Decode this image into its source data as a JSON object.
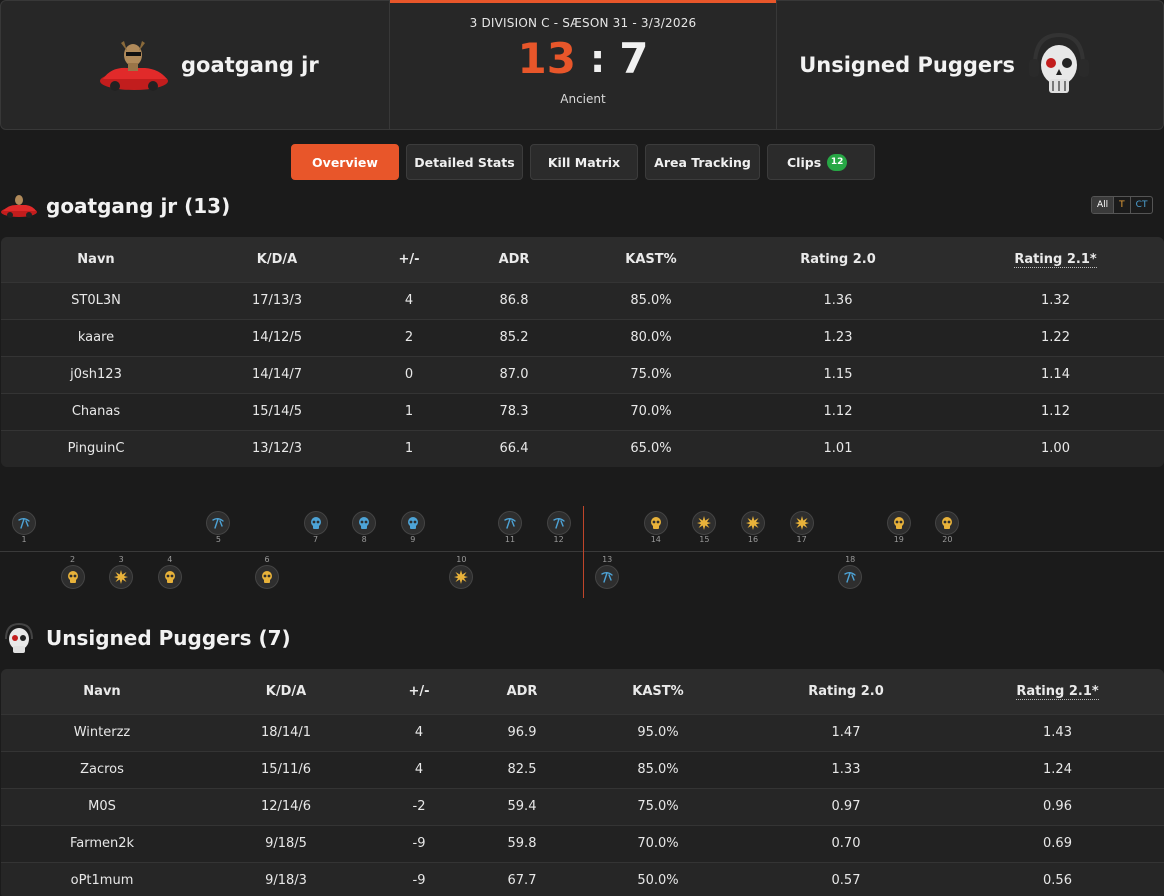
{
  "match": {
    "team1_name": "goatgang jr",
    "team2_name": "Unsigned Puggers",
    "info": "3 DIVISION C - SÆSON 31 - 3/3/2026",
    "score1": "13",
    "score_sep": ":",
    "score2": "7",
    "map": "Ancient"
  },
  "tabs": [
    {
      "label": "Overview",
      "active": true
    },
    {
      "label": "Detailed Stats"
    },
    {
      "label": "Kill Matrix"
    },
    {
      "label": "Area Tracking"
    },
    {
      "label": "Clips",
      "badge": "12"
    }
  ],
  "side_filter": [
    "All",
    "T",
    "CT"
  ],
  "team1_section": {
    "title": "goatgang jr (13)",
    "headers": [
      "Navn",
      "K/D/A",
      "+/-",
      "ADR",
      "KAST%",
      "Rating 2.0",
      "Rating 2.1*"
    ],
    "rows": [
      [
        "ST0L3N",
        "17/13/3",
        "4",
        "86.8",
        "85.0%",
        "1.36",
        "1.32"
      ],
      [
        "kaare",
        "14/12/5",
        "2",
        "85.2",
        "80.0%",
        "1.23",
        "1.22"
      ],
      [
        "j0sh123",
        "14/14/7",
        "0",
        "87.0",
        "75.0%",
        "1.15",
        "1.14"
      ],
      [
        "Chanas",
        "15/14/5",
        "1",
        "78.3",
        "70.0%",
        "1.12",
        "1.12"
      ],
      [
        "PinguinC",
        "13/12/3",
        "1",
        "66.4",
        "65.0%",
        "1.01",
        "1.00"
      ]
    ]
  },
  "team2_section": {
    "title": "Unsigned Puggers (7)",
    "headers": [
      "Navn",
      "K/D/A",
      "+/-",
      "ADR",
      "KAST%",
      "Rating 2.0",
      "Rating 2.1*"
    ],
    "rows": [
      [
        "Winterzz",
        "18/14/1",
        "4",
        "96.9",
        "95.0%",
        "1.47",
        "1.43"
      ],
      [
        "Zacros",
        "15/11/6",
        "4",
        "82.5",
        "85.0%",
        "1.33",
        "1.24"
      ],
      [
        "M0S",
        "12/14/6",
        "-2",
        "59.4",
        "75.0%",
        "0.97",
        "0.96"
      ],
      [
        "Farmen2k",
        "9/18/5",
        "-9",
        "59.8",
        "70.0%",
        "0.70",
        "0.69"
      ],
      [
        "oPt1mum",
        "9/18/3",
        "-9",
        "67.7",
        "50.0%",
        "0.57",
        "0.56"
      ]
    ]
  },
  "rounds": [
    {
      "n": "1",
      "winner": "top",
      "type": "defuse-icon",
      "color": "#4da3d6"
    },
    {
      "n": "2",
      "winner": "bottom",
      "type": "skull-icon",
      "color": "#e8b23a"
    },
    {
      "n": "3",
      "winner": "bottom",
      "type": "bomb-explode-icon",
      "color": "#e8b23a"
    },
    {
      "n": "4",
      "winner": "bottom",
      "type": "skull-icon",
      "color": "#e8b23a"
    },
    {
      "n": "5",
      "winner": "top",
      "type": "defuse-icon",
      "color": "#4da3d6"
    },
    {
      "n": "6",
      "winner": "bottom",
      "type": "skull-icon",
      "color": "#e8b23a"
    },
    {
      "n": "7",
      "winner": "top",
      "type": "skull-icon",
      "color": "#4da3d6"
    },
    {
      "n": "8",
      "winner": "top",
      "type": "skull-icon",
      "color": "#4da3d6"
    },
    {
      "n": "9",
      "winner": "top",
      "type": "skull-icon",
      "color": "#4da3d6"
    },
    {
      "n": "10",
      "winner": "bottom",
      "type": "bomb-explode-icon",
      "color": "#e8b23a"
    },
    {
      "n": "11",
      "winner": "top",
      "type": "defuse-icon",
      "color": "#4da3d6"
    },
    {
      "n": "12",
      "winner": "top",
      "type": "defuse-icon",
      "color": "#4da3d6"
    },
    {
      "n": "13",
      "winner": "bottom",
      "type": "defuse-icon",
      "color": "#4da3d6"
    },
    {
      "n": "14",
      "winner": "top",
      "type": "skull-icon",
      "color": "#e8b23a"
    },
    {
      "n": "15",
      "winner": "top",
      "type": "bomb-explode-icon",
      "color": "#e8b23a"
    },
    {
      "n": "16",
      "winner": "top",
      "type": "bomb-explode-icon",
      "color": "#e8b23a"
    },
    {
      "n": "17",
      "winner": "top",
      "type": "bomb-explode-icon",
      "color": "#e8b23a"
    },
    {
      "n": "18",
      "winner": "bottom",
      "type": "defuse-icon",
      "color": "#4da3d6"
    },
    {
      "n": "19",
      "winner": "top",
      "type": "skull-icon",
      "color": "#e8b23a"
    },
    {
      "n": "20",
      "winner": "top",
      "type": "skull-icon",
      "color": "#e8b23a"
    }
  ],
  "colors": {
    "accent": "#e8562a",
    "ct": "#4da3d6",
    "t": "#e8b23a",
    "badge": "#27a745"
  }
}
